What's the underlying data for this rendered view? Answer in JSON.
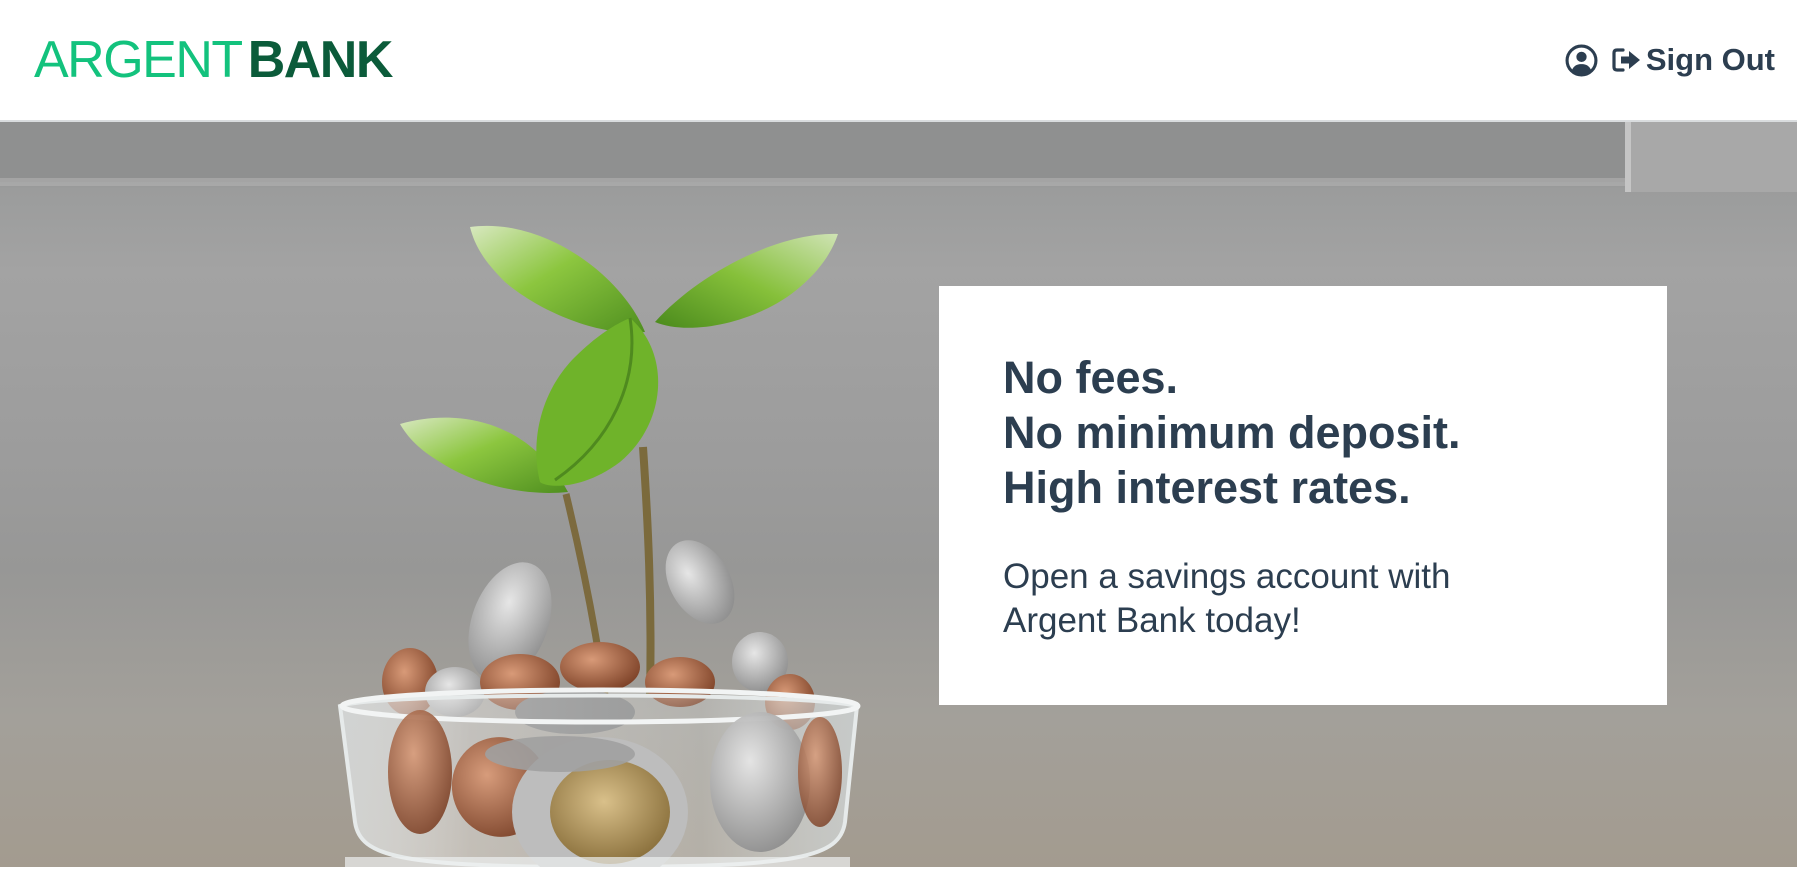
{
  "header": {
    "logo": {
      "part1": "ARGENT",
      "part2": "BANK"
    },
    "nav": {
      "user_icon": "user-circle-icon",
      "signout_icon": "sign-out-icon",
      "signout_label": "Sign Out"
    }
  },
  "hero": {
    "image": "plant-growing-from-coins-in-glass",
    "promo": {
      "lines": [
        "No fees.",
        "No minimum deposit.",
        "High interest rates."
      ],
      "text": "Open a savings account with Argent Bank today!"
    }
  },
  "colors": {
    "brand_light": "#13c27d",
    "brand_dark": "#0b5b3a",
    "text": "#2c3e50"
  }
}
